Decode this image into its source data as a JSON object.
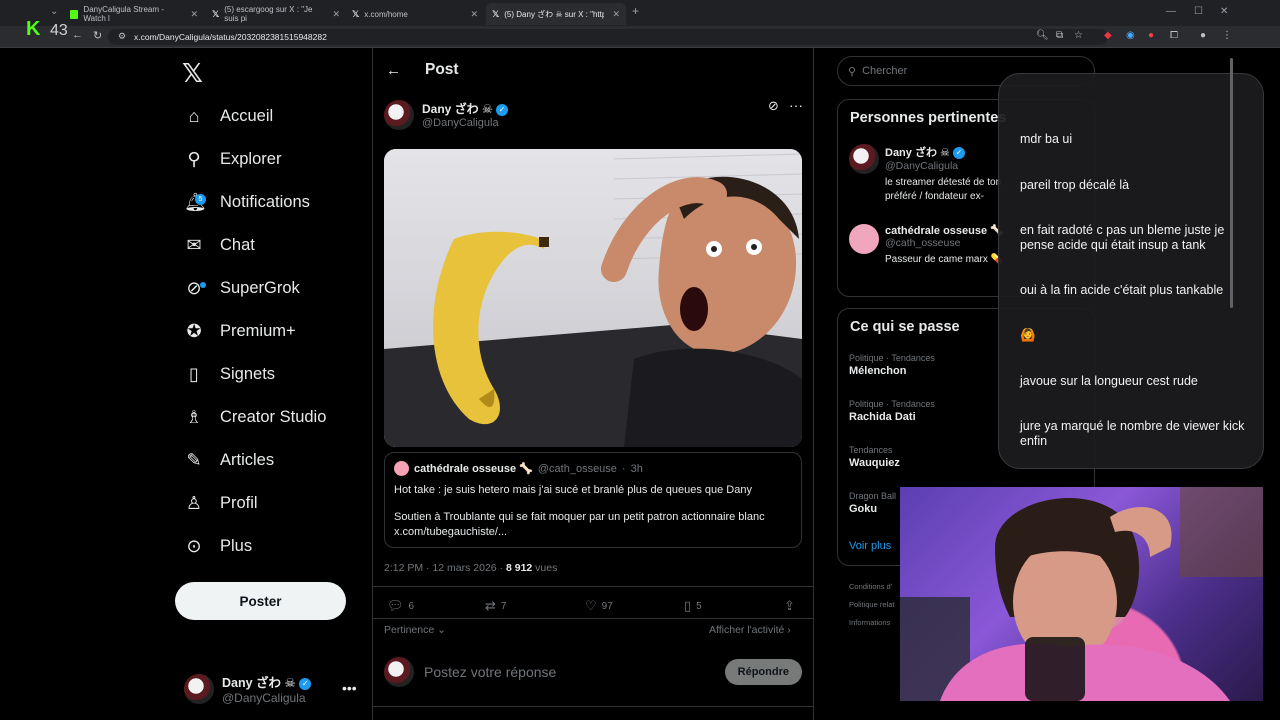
{
  "browser": {
    "tabs": [
      {
        "title": "DanyCaligula Stream - Watch l",
        "icon": "kick-icon"
      },
      {
        "title": "(5) escargoog sur X : \"Je suis pi",
        "icon": "x-icon"
      },
      {
        "title": "x.com/home",
        "icon": "x-icon"
      },
      {
        "title": "(5) Dany ざわ ☠ sur X : \"https:/",
        "icon": "x-icon",
        "active": true
      }
    ],
    "url": "x.com/DanyCaligula/status/2032082381515948282"
  },
  "stream_overlay": {
    "logo": "K",
    "viewer_count": "43"
  },
  "nav": {
    "items": [
      {
        "label": "Accueil",
        "icon": "home-icon"
      },
      {
        "label": "Explorer",
        "icon": "search-icon"
      },
      {
        "label": "Notifications",
        "icon": "bell-icon",
        "badge": "5"
      },
      {
        "label": "Chat",
        "icon": "mail-icon"
      },
      {
        "label": "SuperGrok",
        "icon": "grok-icon"
      },
      {
        "label": "Premium+",
        "icon": "premium-icon"
      },
      {
        "label": "Signets",
        "icon": "bookmark-icon"
      },
      {
        "label": "Creator Studio",
        "icon": "creator-icon"
      },
      {
        "label": "Articles",
        "icon": "article-icon"
      },
      {
        "label": "Profil",
        "icon": "profile-icon"
      },
      {
        "label": "Plus",
        "icon": "more-icon"
      }
    ],
    "post_button": "Poster",
    "account": {
      "name": "Dany ざわ ☠",
      "handle": "@DanyCaligula"
    }
  },
  "post": {
    "header": "Post",
    "author": {
      "name": "Dany ざわ ☠",
      "handle": "@DanyCaligula"
    },
    "quote": {
      "name": "cathédrale osseuse 🦴",
      "handle": "@cath_osseuse",
      "time": "3h",
      "text1": "Hot take : je suis hetero mais j'ai sucé et branlé plus de queues que Dany",
      "text2": "Soutien à Troublante qui se fait moquer par un petit patron actionnaire blanc",
      "link": "x.com/tubegauchiste/..."
    },
    "time": "2:12 PM · 12 mars 2026 · ",
    "views": "8 912",
    "views_label": " vues",
    "stats": {
      "replies": "6",
      "reposts": "7",
      "likes": "97",
      "bookmarks": "5"
    },
    "sort_label": "Pertinence",
    "activity_label": "Afficher l'activité",
    "reply_placeholder": "Postez votre réponse",
    "reply_button": "Répondre"
  },
  "sidebar": {
    "search_placeholder": "Chercher",
    "relevant": {
      "title": "Personnes pertinentes",
      "people": [
        {
          "name": "Dany ざわ ☠",
          "handle": "@DanyCaligula",
          "bio": "le streamer détesté de ton préféré / fondateur ex-"
        },
        {
          "name": "cathédrale osseuse 🦴",
          "handle": "@cath_osseuse",
          "bio": "Passeur de came marx 💊"
        }
      ]
    },
    "trends": {
      "title": "Ce qui se passe",
      "items": [
        {
          "category": "Politique · Tendances",
          "name": "Mélenchon"
        },
        {
          "category": "Politique · Tendances",
          "name": "Rachida Dati"
        },
        {
          "category": "Tendances",
          "name": "Wauquiez"
        },
        {
          "category": "Dragon Ball",
          "name": "Goku"
        }
      ],
      "more": "Voir plus"
    },
    "footer": [
      "Conditions d'",
      "Politique relat",
      "Informations"
    ]
  },
  "chat": {
    "messages": [
      "mdr ba ui",
      "pareil trop décalé là",
      "en fait radoté c pas un bleme juste je pense acide qui était insup a tank",
      "oui à la fin acide c'était plus tankable",
      "🙆",
      "javoue sur la longueur cest rude",
      "jure ya marqué le nombre de viewer kick enfin"
    ]
  }
}
